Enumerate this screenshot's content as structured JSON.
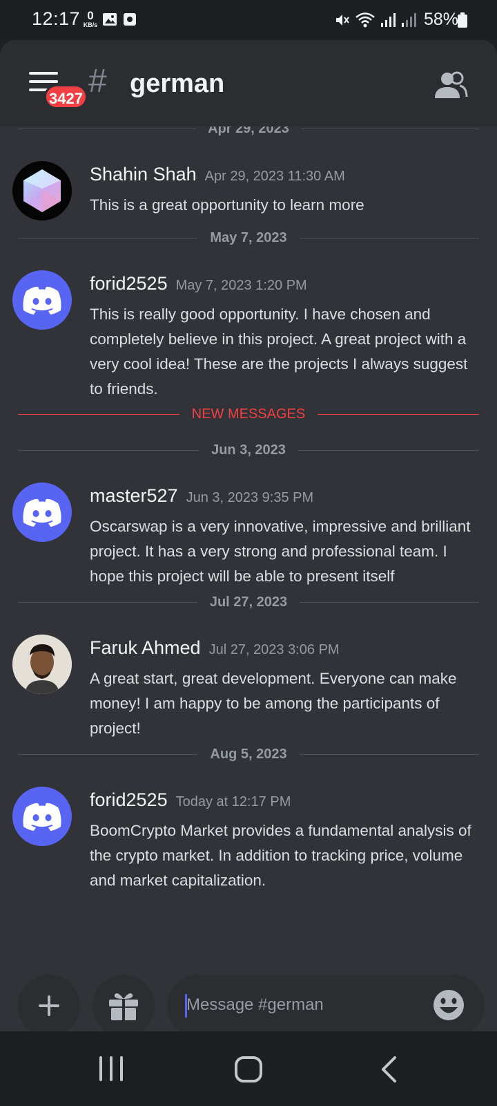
{
  "status_bar": {
    "time": "12:17",
    "net_speed": "0",
    "net_unit": "KB/s",
    "battery": "58%"
  },
  "header": {
    "unread_badge": "3427",
    "hash": "#",
    "channel": "german"
  },
  "dividers": {
    "d1": "Apr 29, 2023",
    "d2": "May 7, 2023",
    "new": "NEW MESSAGES",
    "d3": "Jun 3, 2023",
    "d4": "Jul 27, 2023",
    "d5": "Aug 5, 2023"
  },
  "messages": [
    {
      "author": "Shahin Shah",
      "timestamp": "Apr 29, 2023 11:30 AM",
      "text": "This is a great opportunity to learn more",
      "avatar": "crystal-avatar"
    },
    {
      "author": "forid2525",
      "timestamp": "May 7, 2023 1:20 PM",
      "text": "This is really good opportunity. I have chosen and completely believe in this project. A great project with a very cool idea! These are the projects I always suggest to friends.",
      "avatar": "discord-default-avatar"
    },
    {
      "author": "master527",
      "timestamp": "Jun 3, 2023 9:35 PM",
      "text": "Oscarswap is a very innovative, impressive and brilliant project. It has a very strong and professional team. I hope this project will be able to present itself",
      "avatar": "discord-default-avatar"
    },
    {
      "author": "Faruk Ahmed",
      "timestamp": "Jul 27, 2023 3:06 PM",
      "text": "A great start, great development. Everyone can make money! I am happy to be among the participants of project!",
      "avatar": "photo-avatar"
    },
    {
      "author": "forid2525",
      "timestamp": "Today at 12:17 PM",
      "text": "BoomCrypto Market provides a fundamental analysis of the crypto market. In addition to tracking price, volume and market capitalization.",
      "avatar": "discord-default-avatar"
    }
  ],
  "composer": {
    "placeholder": "Message #german"
  },
  "colors": {
    "blurple": "#5865f2",
    "red": "#f23f43",
    "background": "#313338",
    "header": "#2b2d31"
  }
}
